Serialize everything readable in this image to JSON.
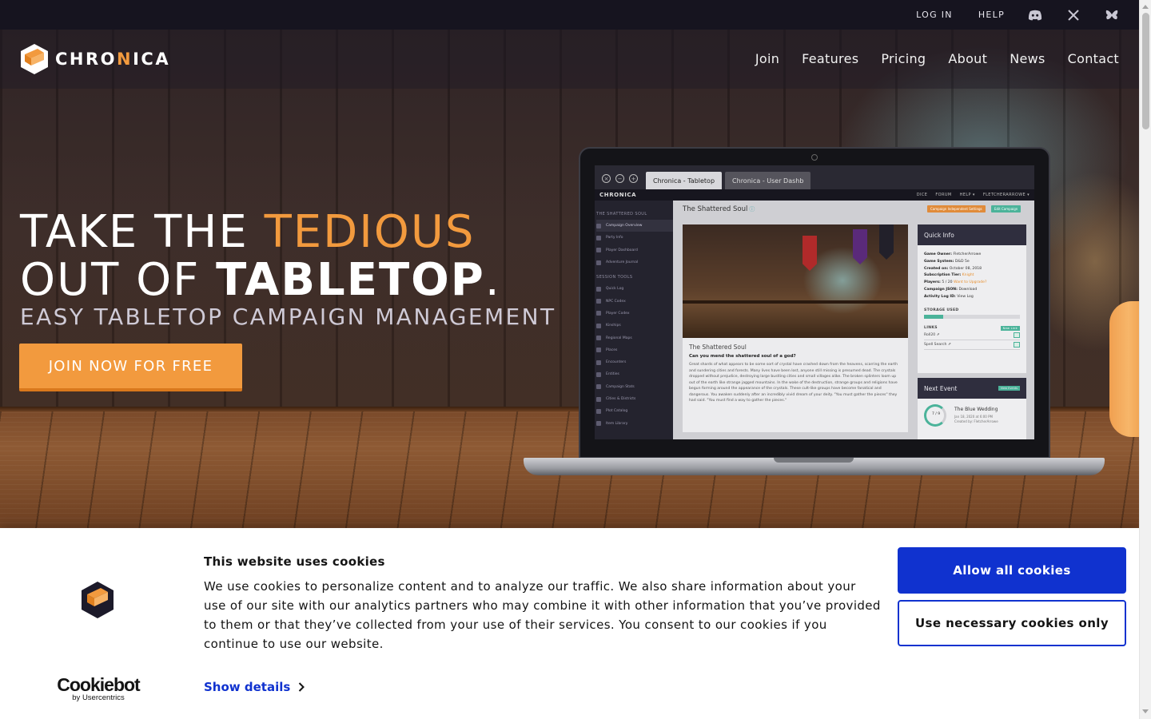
{
  "topbar": {
    "login": "LOG IN",
    "help": "HELP",
    "social": [
      "discord-icon",
      "x-icon",
      "bluesky-icon"
    ]
  },
  "brand": {
    "name_part1": "CHRO",
    "name_highlight": "N",
    "name_part2": "ICA",
    "accent": "#f29a3e"
  },
  "nav": {
    "items": [
      "Join",
      "Features",
      "Pricing",
      "About",
      "News",
      "Contact"
    ]
  },
  "hero": {
    "line1_plain": "TAKE THE ",
    "line1_accent": "TEDIOUS",
    "line2_plain": "OUT OF ",
    "line2_bold": "TABLETOP",
    "line2_end": ".",
    "subheading": "EASY TABLETOP CAMPAIGN MANAGEMENT",
    "cta": "JOIN NOW FOR FREE"
  },
  "laptop_screen": {
    "window_controls": [
      "×",
      "−",
      "+"
    ],
    "tabs": [
      "Chronica - Tabletop",
      "Chronica - User Dashb"
    ],
    "app_brand": "CHRONICA",
    "header_links": [
      "DICE",
      "FORUM",
      "HELP ▾",
      "FLETCHERARROWE ▾"
    ],
    "sidebar_heading_1": "THE SHATTERED SOUL",
    "sidebar_group_1": [
      "Campaign Overview",
      "Party Info",
      "Player Dashboard",
      "Adventure Journal"
    ],
    "sidebar_heading_2": "SESSION TOOLS",
    "sidebar_group_2": [
      "Quick Log",
      "NPC Codex",
      "Player Codex",
      "Kinships",
      "Regional Maps",
      "Places",
      "Encounters",
      "Entities",
      "Campaign Stats",
      "Cities & Districts",
      "Plot Catalog",
      "Item Library"
    ],
    "campaign_title": "The Shattered Soul",
    "info_glyph": "ⓘ",
    "action_1": "Campaign Independent Settings",
    "action_2": "Edit Campaign",
    "story_title": "The Shattered Soul",
    "story_question": "Can you mend the shattered soul of a god?",
    "story_body": "Great shards of what appears to be some sort of crystal have crashed down from the heavens, scarring the earth and sundering cities and forests. Many lives have been lost, anyone still missing is presumed dead. The crystals dropped without prejudice, destroying large bustling cities and small villages alike. The broken splinters loom up out of the earth like strange jagged mountains. In the wake of the destruction, strange groups and religions have begun forming around the appearance of the crystals. These cult-like groups have become fanatical and dangerous. You awaken suddenly after an incredibly vivid dream of your deity. \"You must gather the pieces\" they had said. \"You must find a way to gather the pieces.\"",
    "quick_info": {
      "title": "Quick Info",
      "rows": [
        {
          "label": "Game Owner:",
          "value": "FletcherArrowe"
        },
        {
          "label": "Game System:",
          "value": "D&D 5e"
        },
        {
          "label": "Created on:",
          "value": "October 08, 2018"
        },
        {
          "label": "Subscription Tier:",
          "value": "Knight"
        },
        {
          "label": "Players:",
          "value": "5 / 20"
        },
        {
          "label": "Campaign JSON:",
          "value": "Download"
        },
        {
          "label": "Activity Log ID:",
          "value": "View Log"
        }
      ],
      "players_extra": "Want to Upgrade?",
      "storage_label": "STORAGE USED",
      "storage_used": 0.2,
      "links_label": "LINKS",
      "links_action": "New Link",
      "links": [
        "Roll20 ⇗",
        "Spell Search ⇗"
      ]
    },
    "next_event": {
      "title": "Next Event",
      "action": "View Events",
      "ring": "7 / 9",
      "name": "The Blue Wedding",
      "meta_1": "Jan 18, 2020 at 6:00 PM",
      "meta_2": "Created by: FletcherArrowe"
    }
  },
  "cookie_banner": {
    "title": "This website uses cookies",
    "text": "We use cookies to personalize content and to analyze our traffic. We also share information about your use of our site with our analytics partners who may combine it with other information that you’ve provided to them or that they’ve collected from your use of their services. You consent to our cookies if you continue to use our website.",
    "show_details": "Show details",
    "allow_all": "Allow all cookies",
    "necessary_only": "Use necessary cookies only",
    "provider_name": "Cookiebot",
    "provider_sub": "by Usercentrics",
    "primary_color": "#1032cf"
  }
}
